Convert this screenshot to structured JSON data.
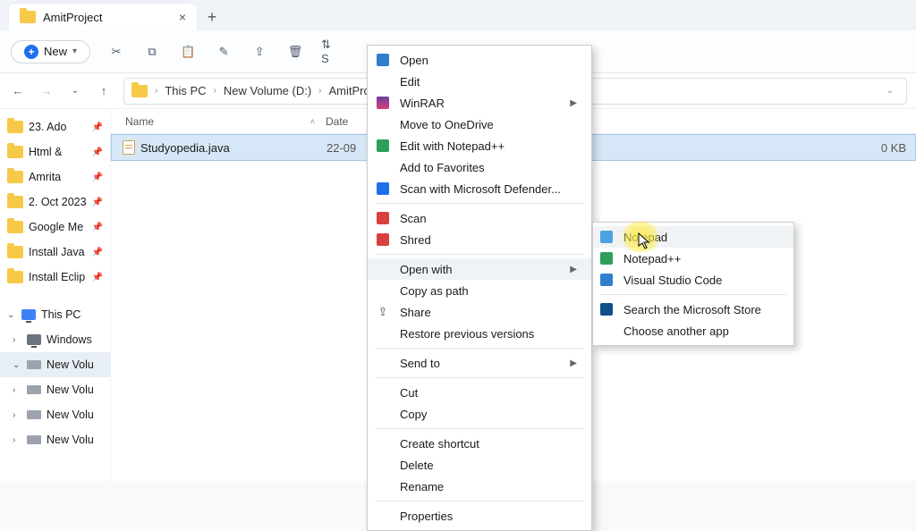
{
  "tab": {
    "title": "AmitProject"
  },
  "toolbar": {
    "new": "New"
  },
  "breadcrumb": {
    "root": "This PC",
    "vol": "New Volume (D:)",
    "folder": "AmitProject"
  },
  "sidebar": {
    "quick": [
      {
        "label": "23. Ado"
      },
      {
        "label": "Html &"
      },
      {
        "label": "Amrita"
      },
      {
        "label": "2. Oct 2023"
      },
      {
        "label": "Google Me"
      },
      {
        "label": "Install Java"
      },
      {
        "label": "Install Eclip"
      }
    ],
    "thispc": "This PC",
    "drives": [
      {
        "label": "Windows",
        "expanded": false,
        "sel": false
      },
      {
        "label": "New Volu",
        "expanded": true,
        "sel": true
      },
      {
        "label": "New Volu",
        "expanded": false,
        "sel": false
      },
      {
        "label": "New Volu",
        "expanded": false,
        "sel": false
      },
      {
        "label": "New Volu",
        "expanded": false,
        "sel": false
      }
    ]
  },
  "columns": {
    "name": "Name",
    "date": "Date",
    "size_header": ""
  },
  "files": [
    {
      "name": "Studyopedia.java",
      "date": "22-09",
      "size": "0 KB"
    }
  ],
  "ctx1": [
    {
      "icon": "vscode",
      "label": "Open"
    },
    {
      "icon": "",
      "label": "Edit"
    },
    {
      "icon": "winrar",
      "label": "WinRAR",
      "expand": true
    },
    {
      "icon": "",
      "label": "Move to OneDrive"
    },
    {
      "icon": "npp",
      "label": "Edit with Notepad++"
    },
    {
      "icon": "",
      "label": "Add to Favorites"
    },
    {
      "icon": "defender",
      "label": "Scan with Microsoft Defender..."
    },
    {
      "sep": true
    },
    {
      "icon": "mcafee",
      "label": "Scan"
    },
    {
      "icon": "mcafee",
      "label": "Shred"
    },
    {
      "sep": true
    },
    {
      "icon": "",
      "label": "Open with",
      "expand": true,
      "hov": true
    },
    {
      "icon": "",
      "label": "Copy as path"
    },
    {
      "icon": "share",
      "label": "Share"
    },
    {
      "icon": "",
      "label": "Restore previous versions"
    },
    {
      "sep": true
    },
    {
      "icon": "",
      "label": "Send to",
      "expand": true
    },
    {
      "sep": true
    },
    {
      "icon": "",
      "label": "Cut"
    },
    {
      "icon": "",
      "label": "Copy"
    },
    {
      "sep": true
    },
    {
      "icon": "",
      "label": "Create shortcut"
    },
    {
      "icon": "",
      "label": "Delete"
    },
    {
      "icon": "",
      "label": "Rename"
    },
    {
      "sep": true
    },
    {
      "icon": "",
      "label": "Properties"
    }
  ],
  "ctx2": [
    {
      "icon": "notepad",
      "label": "Notepad",
      "hov": true
    },
    {
      "icon": "npp",
      "label": "Notepad++"
    },
    {
      "icon": "vscode",
      "label": "Visual Studio Code"
    },
    {
      "sep": true
    },
    {
      "icon": "store",
      "label": "Search the Microsoft Store"
    },
    {
      "icon": "",
      "label": "Choose another app"
    }
  ]
}
